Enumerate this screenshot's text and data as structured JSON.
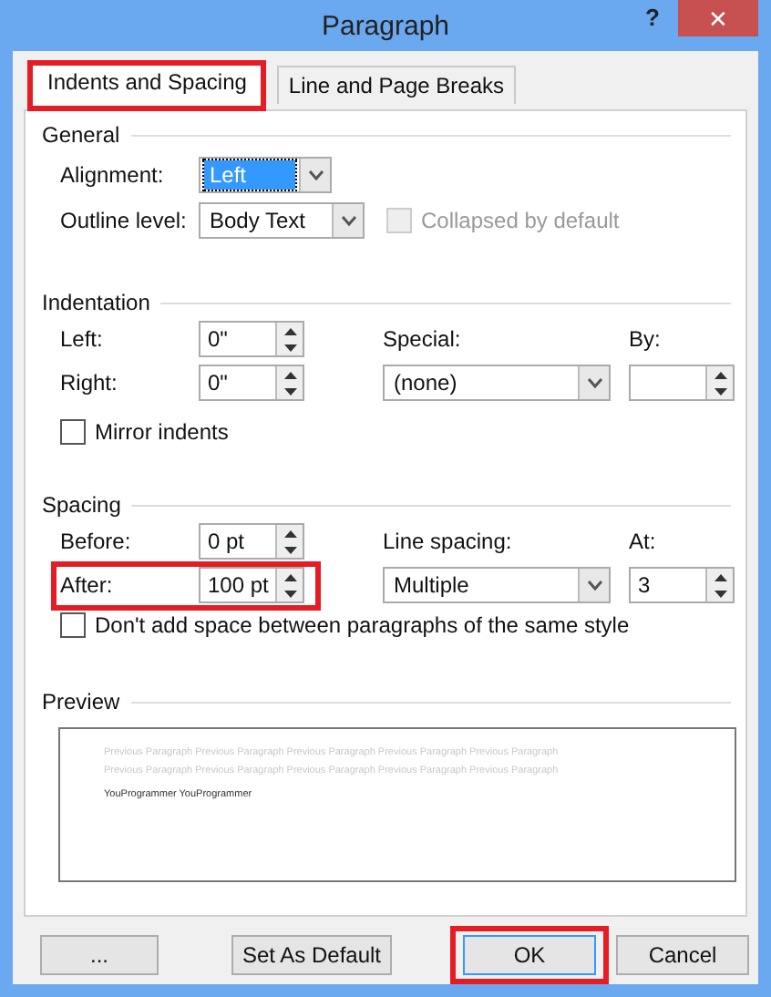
{
  "window": {
    "title": "Paragraph",
    "help": "?",
    "close": "✕"
  },
  "tabs": [
    {
      "label": "Indents and Spacing",
      "selected": true,
      "highlighted": true
    },
    {
      "label": "Line and Page Breaks",
      "selected": false,
      "highlighted": false
    }
  ],
  "general": {
    "heading": "General",
    "alignment": {
      "label": "Alignment:",
      "value": "Left",
      "focused": true
    },
    "outline_level": {
      "label": "Outline level:",
      "value": "Body Text",
      "focused": false
    },
    "collapsed": {
      "label": "Collapsed by default",
      "checked": false,
      "disabled": true
    }
  },
  "indentation": {
    "heading": "Indentation",
    "left": {
      "label": "Left:",
      "value": "0\"",
      "highlighted": false
    },
    "right": {
      "label": "Right:",
      "value": "0\"",
      "highlighted": false
    },
    "special": {
      "label": "Special:",
      "value": "(none)",
      "focused": false
    },
    "by": {
      "label": "By:",
      "highlighted": false
    },
    "mirror": {
      "label": "Mirror indents",
      "checked": false,
      "disabled": false
    }
  },
  "spacing": {
    "heading": "Spacing",
    "before": {
      "label": "Before:",
      "value": "0 pt",
      "highlighted": false
    },
    "after": {
      "label": "After:",
      "value": "100 pt",
      "highlighted": true
    },
    "line_spacing": {
      "label": "Line spacing:",
      "value": "Multiple",
      "focused": false
    },
    "at": {
      "label": "At:",
      "value": "3",
      "highlighted": false
    },
    "dont_add": {
      "label": "Don't add space between paragraphs of the same style",
      "checked": false,
      "disabled": false
    }
  },
  "preview": {
    "heading": "Preview",
    "previous_lines": [
      "Previous Paragraph Previous Paragraph Previous Paragraph Previous Paragraph Previous Paragraph",
      "Previous Paragraph Previous Paragraph Previous Paragraph Previous Paragraph Previous Paragraph"
    ],
    "current_text": "YouProgrammer YouProgrammer"
  },
  "buttons": [
    {
      "label": "...",
      "highlighted": false,
      "default": false
    },
    {
      "label": "Set As Default",
      "highlighted": false,
      "default": false
    },
    {
      "label": "OK",
      "highlighted": true,
      "default": true
    },
    {
      "label": "Cancel",
      "highlighted": false,
      "default": false
    }
  ]
}
